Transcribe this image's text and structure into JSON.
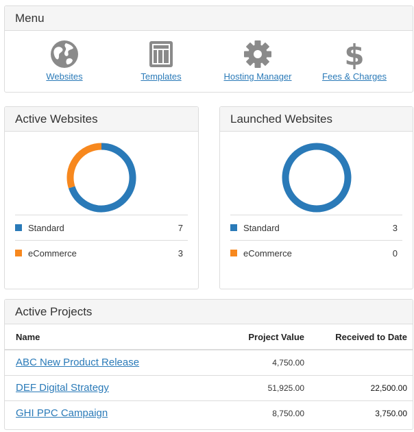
{
  "menu": {
    "title": "Menu",
    "items": [
      {
        "label": "Websites",
        "icon": "globe-icon"
      },
      {
        "label": "Templates",
        "icon": "template-icon"
      },
      {
        "label": "Hosting Manager",
        "icon": "gear-icon"
      },
      {
        "label": "Fees & Charges",
        "icon": "dollar-icon"
      }
    ]
  },
  "colors": {
    "standard": "#2a7ab8",
    "ecommerce": "#f7881e",
    "icon": "#8a8a8a",
    "link": "#2a7ab8"
  },
  "active_websites": {
    "title": "Active Websites",
    "legend": [
      {
        "label": "Standard",
        "count": "7",
        "value": 7
      },
      {
        "label": "eCommerce",
        "count": "3",
        "value": 3
      }
    ]
  },
  "launched_websites": {
    "title": "Launched Websites",
    "legend": [
      {
        "label": "Standard",
        "count": "3",
        "value": 3
      },
      {
        "label": "eCommerce",
        "count": "0",
        "value": 0
      }
    ]
  },
  "projects": {
    "title": "Active Projects",
    "columns": [
      "Name",
      "Project Value",
      "Received to Date"
    ],
    "rows": [
      {
        "name": "ABC New Product Release",
        "value": "4,750.00",
        "received": ""
      },
      {
        "name": "DEF Digital Strategy",
        "value": "51,925.00",
        "received": "22,500.00"
      },
      {
        "name": "GHI PPC Campaign",
        "value": "8,750.00",
        "received": "3,750.00"
      }
    ]
  }
}
